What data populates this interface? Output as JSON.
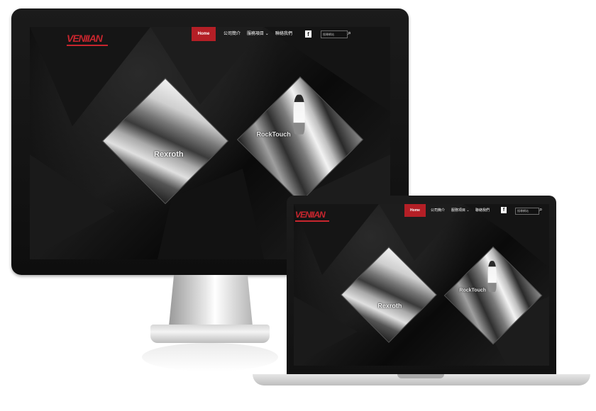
{
  "site": {
    "logo_text": "VENIIAN",
    "nav": {
      "home": "Home",
      "about": "公司簡介",
      "services": "服務項目",
      "services_chevron": "⌄",
      "contact": "聯絡我們"
    },
    "facebook_label": "f",
    "search_placeholder": "搜尋網站",
    "search_icon": "⌕",
    "photo_caption_left": "Rexroth",
    "photo_caption_right": "RockTouch"
  },
  "colors": {
    "accent": "#b41f26",
    "background": "#0b0b0b",
    "text": "#ffffff"
  }
}
